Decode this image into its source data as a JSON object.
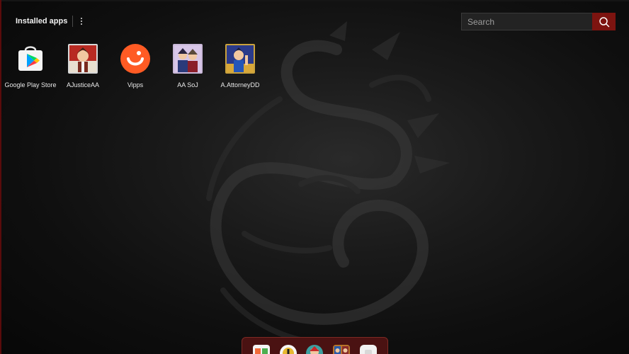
{
  "header": {
    "title": "Installed apps",
    "menu_icon": "more-vertical-icon"
  },
  "search": {
    "placeholder": "Search",
    "value": "",
    "icon": "search-icon",
    "button_color": "#7d1410"
  },
  "apps": [
    {
      "label": "Google Play Store",
      "icon": "google-play-store-icon"
    },
    {
      "label": "AJusticeAA",
      "icon": "ajusticeaa-app-icon"
    },
    {
      "label": "Vipps",
      "icon": "vipps-app-icon",
      "color": "#ff5b24"
    },
    {
      "label": "AA  SoJ",
      "icon": "aa-soj-app-icon"
    },
    {
      "label": "A.AttorneyDD",
      "icon": "attorney-dd-app-icon"
    }
  ],
  "dock": {
    "items": [
      {
        "icon": "gallery-app-icon"
      },
      {
        "icon": "coin-app-icon"
      },
      {
        "icon": "game-character-app-icon"
      },
      {
        "icon": "game-art-app-icon"
      },
      {
        "icon": "white-app-icon"
      }
    ]
  },
  "wallpaper": {
    "icon": "dragon-logo-icon",
    "accent": "#7d1410"
  }
}
